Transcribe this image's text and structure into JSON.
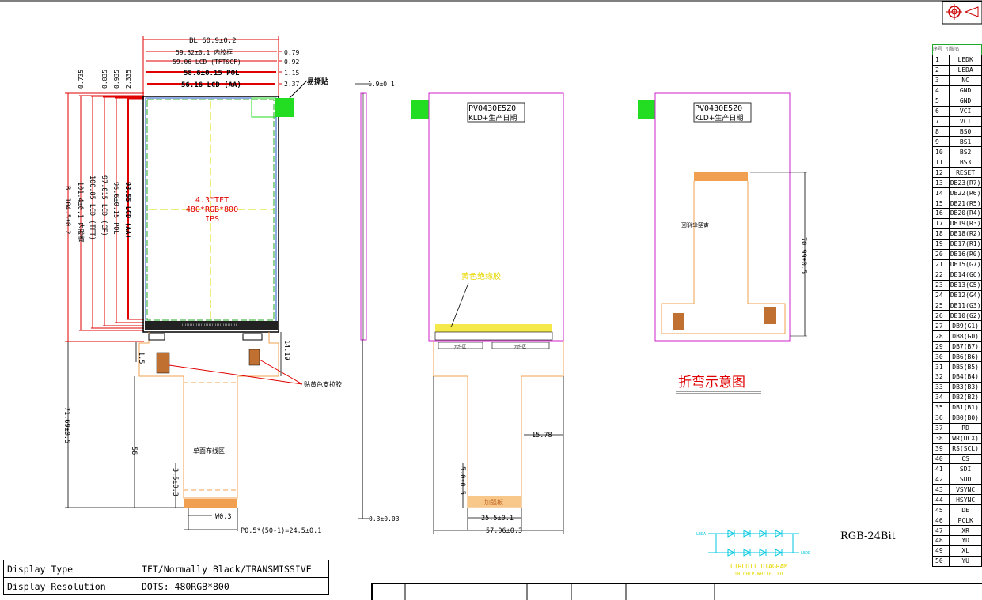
{
  "drawing": {
    "dims_top": [
      "BL 60.9±0.2",
      "59.32±0.1 内胶框",
      "59.06 LCD (TFT&CF)",
      "58.6±0.15 POL",
      "56.16 LCD (AA)"
    ],
    "dims_top_right": [
      "0.79",
      "0.92",
      "1.15",
      "2.37"
    ],
    "dims_vert_small": [
      "0.735",
      "0.835",
      "0.935",
      "2.335"
    ],
    "dims_left": [
      "BL 104.5±0.2",
      "101.4±0.1 内胶框",
      "100.85 LCD (TFT)",
      "97.015 LCD (CF)",
      "96.6±0.15 POL",
      "93.55 LCD (AA)"
    ],
    "easy_tear": "易撕贴",
    "panel_label": [
      "4.3\"TFT",
      "480*RGB*800",
      "IPS"
    ],
    "dim_fpc": [
      "1.5",
      "14.19",
      "71.69±0.5",
      "56",
      "3.5±0.3",
      "W0.3",
      "P0.5*(50-1)=24.5±0.1"
    ],
    "fpc_area_label": "单面布线区",
    "yellow_tape_label": "贴黄色支拉胶",
    "side_dims": [
      "1.9±0.1",
      "0.3±0.03"
    ],
    "back_label": [
      "PV0430E5Z0",
      "KLD+生产日期"
    ],
    "yellow_glue": "黄色绝缘胶",
    "center_tags": [
      "元件区",
      "元件区"
    ],
    "back_dims": [
      "15.78",
      "5.0±0.5",
      "25.5±0.1",
      "57.06±0.3"
    ],
    "stiffener": "加强板",
    "fold_dim": "70.99±0.5",
    "fold_title": "折弯示意图",
    "circuit_title": "CIRCUIT DIAGRAM",
    "circuit_sub": "10 CHIP-WHITE LED",
    "circuit_leda": "LEDA",
    "circuit_ledk": "LEDK",
    "rgb_label": "RGB-24Bit"
  },
  "spec_table": [
    {
      "label": "Display Type",
      "value": "TFT/Normally Black/TRANSMISSIVE"
    },
    {
      "label": "Display Resolution",
      "value": "DOTS: 480RGB*800"
    }
  ],
  "pin_header": "序号 引脚名",
  "pins": [
    {
      "no": "1",
      "name": "LEDK"
    },
    {
      "no": "2",
      "name": "LEDA"
    },
    {
      "no": "3",
      "name": "NC"
    },
    {
      "no": "4",
      "name": "GND"
    },
    {
      "no": "5",
      "name": "GND"
    },
    {
      "no": "6",
      "name": "VCI"
    },
    {
      "no": "7",
      "name": "VCI"
    },
    {
      "no": "8",
      "name": "BS0"
    },
    {
      "no": "9",
      "name": "BS1"
    },
    {
      "no": "10",
      "name": "BS2"
    },
    {
      "no": "11",
      "name": "BS3"
    },
    {
      "no": "12",
      "name": "RESET"
    },
    {
      "no": "13",
      "name": "DB23(R7)"
    },
    {
      "no": "14",
      "name": "DB22(R6)"
    },
    {
      "no": "15",
      "name": "DB21(R5)"
    },
    {
      "no": "16",
      "name": "DB20(R4)"
    },
    {
      "no": "17",
      "name": "DB19(R3)"
    },
    {
      "no": "18",
      "name": "DB18(R2)"
    },
    {
      "no": "19",
      "name": "DB17(R1)"
    },
    {
      "no": "20",
      "name": "DB16(R0)"
    },
    {
      "no": "21",
      "name": "DB15(G7)"
    },
    {
      "no": "22",
      "name": "DB14(G6)"
    },
    {
      "no": "23",
      "name": "DB13(G5)"
    },
    {
      "no": "24",
      "name": "DB12(G4)"
    },
    {
      "no": "25",
      "name": "DB11(G3)"
    },
    {
      "no": "26",
      "name": "DB10(G2)"
    },
    {
      "no": "27",
      "name": "DB9(G1)"
    },
    {
      "no": "28",
      "name": "DB8(G0)"
    },
    {
      "no": "29",
      "name": "DB7(B7)"
    },
    {
      "no": "30",
      "name": "DB6(B6)"
    },
    {
      "no": "31",
      "name": "DB5(B5)"
    },
    {
      "no": "32",
      "name": "DB4(B4)"
    },
    {
      "no": "33",
      "name": "DB3(B3)"
    },
    {
      "no": "34",
      "name": "DB2(B2)"
    },
    {
      "no": "35",
      "name": "DB1(B1)"
    },
    {
      "no": "36",
      "name": "DB0(B0)"
    },
    {
      "no": "37",
      "name": "RD"
    },
    {
      "no": "38",
      "name": "WR(DCX)"
    },
    {
      "no": "39",
      "name": "RS(SCL)"
    },
    {
      "no": "40",
      "name": "CS"
    },
    {
      "no": "41",
      "name": "SDI"
    },
    {
      "no": "42",
      "name": "SDO"
    },
    {
      "no": "43",
      "name": "VSYNC"
    },
    {
      "no": "44",
      "name": "HSYNC"
    },
    {
      "no": "45",
      "name": "DE"
    },
    {
      "no": "46",
      "name": "PCLK"
    },
    {
      "no": "47",
      "name": "XR"
    },
    {
      "no": "48",
      "name": "YD"
    },
    {
      "no": "49",
      "name": "XL"
    },
    {
      "no": "50",
      "name": "YU"
    }
  ],
  "colors": {
    "outline": "#cc22cc",
    "fpc": "#f0a050",
    "dim": "#e00000",
    "green": "#22dd22",
    "circuit": "#00c8e0"
  }
}
